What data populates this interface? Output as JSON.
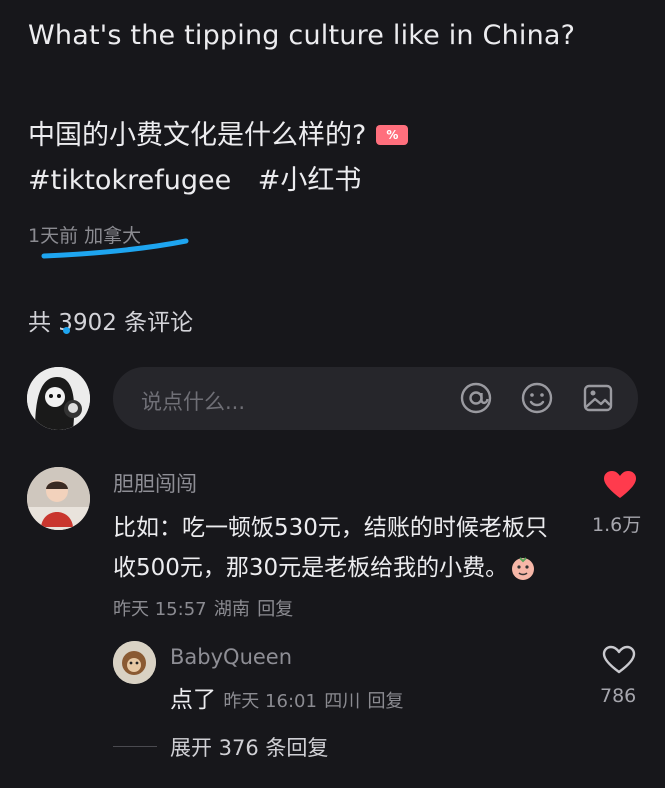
{
  "post": {
    "title_en": "What's the tipping culture like in China?",
    "title_cn": "中国的小费文化是什么样的?",
    "icon_money": "%",
    "tags": [
      "#tiktokrefugee",
      "#小红书"
    ],
    "meta": "1天前 加拿大"
  },
  "comments_header": {
    "label": "共 3902 条评论"
  },
  "input": {
    "placeholder": "说点什么...",
    "icons": [
      "at-icon",
      "emoji-icon",
      "image-icon"
    ]
  },
  "comment": {
    "author": "胆胆闯闯",
    "text": "比如：吃一顿饭530元，结账的时候老板只收500元，那30元是老板给我的小费。",
    "time": "昨天 15:57",
    "location": "湖南",
    "reply_label": "回复",
    "likes": "1.6万",
    "liked": true
  },
  "reply": {
    "author": "BabyQueen",
    "text": "点了",
    "time": "昨天 16:01",
    "location": "四川",
    "reply_label": "回复",
    "likes": "786"
  },
  "expand": {
    "label": "展开 376 条回复"
  },
  "colors": {
    "background": "#17171b",
    "heart_liked": "#ff3b4d",
    "highlight_underline": "#1ea5f0"
  }
}
